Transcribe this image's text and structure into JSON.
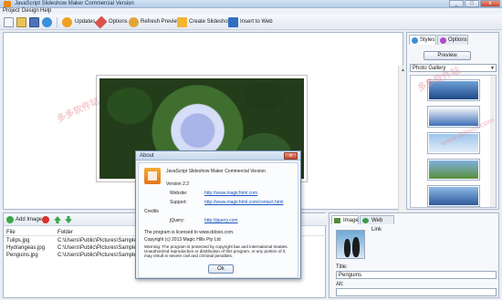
{
  "window": {
    "title": "JavaScript Slideshow Maker Commercial Version",
    "minimize": "_",
    "maximize": "□",
    "close": "x"
  },
  "menu": [
    "Project",
    "Design",
    "Help"
  ],
  "toolbar": {
    "updates": "Updates",
    "options": "Options",
    "refresh_preview": "Refresh Preview",
    "create_slideshow": "Create Slideshow",
    "insert_to_web": "Insert to Web"
  },
  "right_panel": {
    "tab_styles": "Styles",
    "tab_options": "Options",
    "preview_button": "Preview",
    "gallery_select": "Photo Gallery"
  },
  "bottom_list": {
    "add_image": "Add Image",
    "columns": [
      "File",
      "Folder"
    ],
    "rows": [
      {
        "file": "Tulips.jpg",
        "folder": "C:\\Users\\Public\\Pictures\\Sample Picture"
      },
      {
        "file": "Hydrangeas.jpg",
        "folder": "C:\\Users\\Public\\Pictures\\Sample Picture"
      },
      {
        "file": "Penguins.jpg",
        "folder": "C:\\Users\\Public\\Pictures\\Sample Picture"
      }
    ]
  },
  "image_panel": {
    "tab_image": "Image",
    "tab_web_link": "Web Link",
    "title_label": "Title:",
    "title_value": "Penguins",
    "alt_label": "Alt:",
    "alt_value": ""
  },
  "about_dialog": {
    "title": "About",
    "close": "x",
    "product": "JavaScript Slideshow Maker Commercial Version",
    "version": "Version 2.2",
    "website_label": "Website:",
    "website_url": "http://www.magichtml.com",
    "support_label": "Support:",
    "support_url": "http://www.magichtml.com/contact.html",
    "credits_label": "Credits",
    "jquery_label": "jQuery:",
    "jquery_url": "http://jquery.com",
    "licensed": "The program is licensed to www.ddooo.com.",
    "copyright": "Copyright (c) 2013 Magic Hills Pty Ltd",
    "warning": "Warning: The program is protected by copyright law and international treaties. Unauthorized reproduction or distribution of this program, or any portion of it, may result in severe civil and criminal penalties.",
    "ok": "Ok"
  },
  "watermarks": [
    "多多软件站",
    "多多软件站",
    "www.ddooo.com"
  ],
  "colors": {
    "titlebar": "#b7cde6",
    "link": "#1a55b8",
    "accent_orange": "#e8871a"
  }
}
